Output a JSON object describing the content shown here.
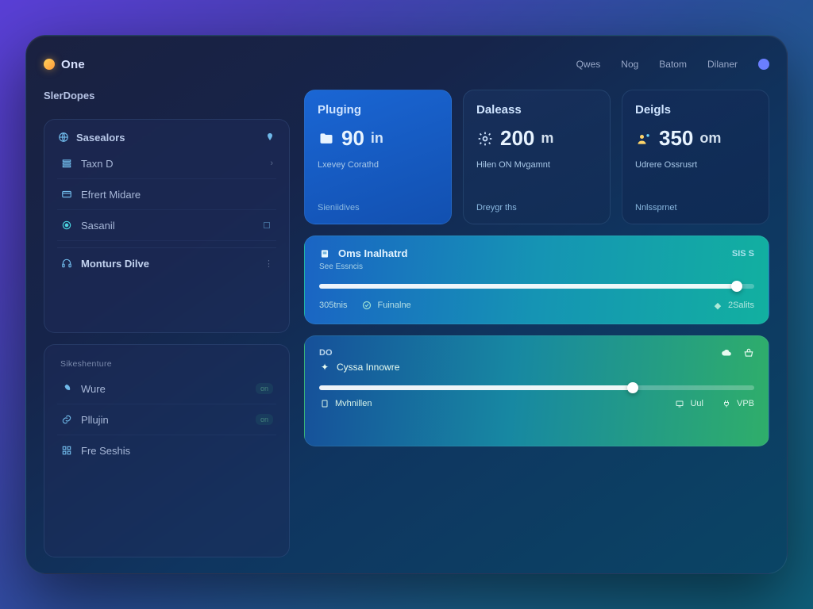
{
  "header": {
    "logo": "One",
    "nav": [
      "Qwes",
      "Nog",
      "Batom",
      "Dilaner"
    ]
  },
  "sidebar": {
    "section1_title": "SlerDopes",
    "card1_head": "Sasealors",
    "items1": [
      {
        "label": "Taxn D",
        "icon": "list-icon"
      },
      {
        "label": "Efrert Midare",
        "icon": "card-icon"
      },
      {
        "label": "Sasanil",
        "icon": "target-icon"
      }
    ],
    "items1_foot": {
      "label": "Monturs Dilve",
      "icon": "headset-icon"
    },
    "section2_title": "Sikeshenture",
    "items2": [
      {
        "label": "Wure",
        "icon": "leaf-icon",
        "pill": "on"
      },
      {
        "label": "Pllujin",
        "icon": "link-icon",
        "pill": "on"
      },
      {
        "label": "Fre Seshis",
        "icon": "grid-icon"
      }
    ]
  },
  "stats": [
    {
      "title": "Pluging",
      "value": "90",
      "unit": "in",
      "sub": "Lxevey Corathd",
      "link": "Sieniidives",
      "icon": "folder-icon"
    },
    {
      "title": "Daleass",
      "value": "200",
      "unit": "m",
      "sub": "Hilen ON Mvgamnt",
      "link": "Dreygr ths",
      "icon": "gear-icon"
    },
    {
      "title": "Deigls",
      "value": "350",
      "unit": "om",
      "sub": "Udrere Ossrusrt",
      "link": "Nnlssprnet",
      "icon": "user-cloud-icon"
    }
  ],
  "panel1": {
    "title": "Oms Inalhatrd",
    "sub": "See Essncis",
    "badge": "SIS S",
    "progress": 96,
    "foot_left": "305tnis",
    "foot_mid": "Fuinalne",
    "foot_right": "2Salits"
  },
  "panel2": {
    "label_left": "DO",
    "title": "Cyssa Innowre",
    "progress": 72,
    "chips": [
      {
        "label": "Mvhnillen",
        "icon": "doc-icon"
      },
      {
        "label": "Uul",
        "icon": "tv-icon"
      },
      {
        "label": "VPB",
        "icon": "plug-icon"
      }
    ],
    "right_icons": [
      "cloud-icon",
      "basket-icon"
    ]
  }
}
